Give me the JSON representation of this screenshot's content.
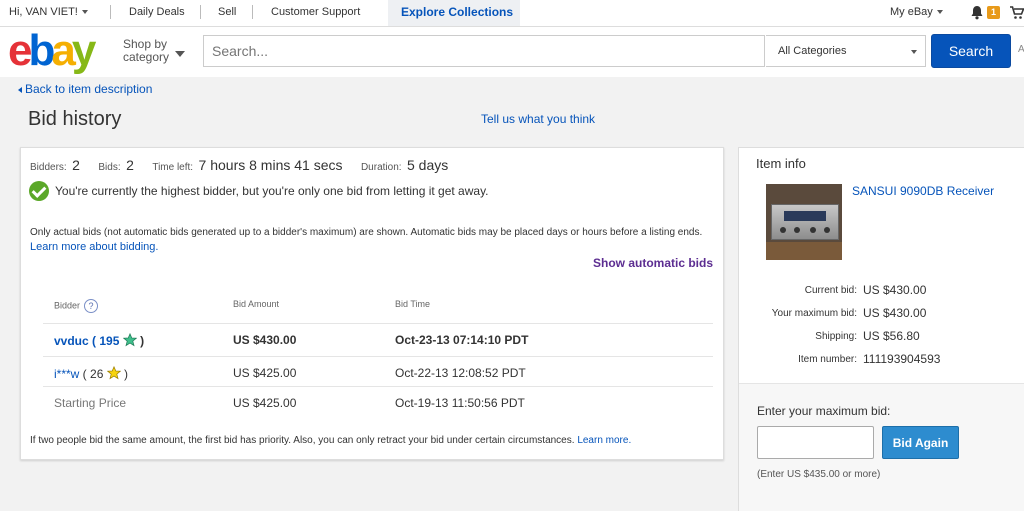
{
  "topbar": {
    "greeting": "Hi, VAN VIET!",
    "links": [
      "Daily Deals",
      "Sell",
      "Customer Support"
    ],
    "explore": "Explore Collections",
    "my_ebay": "My eBay",
    "notification_count": "1"
  },
  "header": {
    "shop_by": "Shop by",
    "category": "category",
    "search_placeholder": "Search...",
    "category_selected": "All Categories",
    "search_button": "Search",
    "advanced": "A"
  },
  "page": {
    "back_link": "Back to item description",
    "title": "Bid history",
    "feedback_link": "Tell us what you think"
  },
  "bids_summary": {
    "bidders_label": "Bidders:",
    "bidders": "2",
    "bids_label": "Bids:",
    "bids": "2",
    "time_left_label": "Time left:",
    "time_left": "7 hours 8 mins 41 secs",
    "duration_label": "Duration:",
    "duration": "5 days",
    "status_message": "You're currently the highest bidder, but you're only one bid from letting it get away.",
    "note": "Only actual bids (not automatic bids generated up to a bidder's maximum) are shown. Automatic bids may be placed days or hours before a listing ends.",
    "note_link": "Learn more about bidding.",
    "show_automatic": "Show automatic bids"
  },
  "bid_table": {
    "headers": {
      "bidder": "Bidder",
      "amount": "Bid Amount",
      "time": "Bid Time"
    },
    "help": "?",
    "rows": [
      {
        "bidder": "vvduc",
        "score": "195",
        "open": " ( ",
        "close": " )",
        "amount": "US $430.00",
        "time": "Oct-23-13 07:14:10 PDT",
        "star": "green-star-icon"
      },
      {
        "bidder": "i***w",
        "score": "26",
        "open": " ( ",
        "close": " )",
        "amount": "US $425.00",
        "time": "Oct-22-13 12:08:52 PDT",
        "star": "yellow-star-icon"
      }
    ],
    "starting": {
      "label": "Starting Price",
      "amount": "US $425.00",
      "time": "Oct-19-13 11:50:56 PDT"
    }
  },
  "footnote": {
    "text": "If two people bid the same amount, the first bid has priority. Also, you can only retract your bid under certain circumstances.",
    "link": "Learn more."
  },
  "item_info": {
    "title": "Item info",
    "item_name": "SANSUI 9090DB Receiver",
    "current_bid_label": "Current bid:",
    "current_bid": "US $430.00",
    "max_bid_label": "Your maximum bid:",
    "max_bid": "US $430.00",
    "shipping_label": "Shipping:",
    "shipping": "US $56.80",
    "item_number_label": "Item number:",
    "item_number": "111193904593",
    "enter_max_label": "Enter your maximum bid:",
    "bid_again": "Bid Again",
    "hint": "(Enter US $435.00 or more)"
  },
  "colors": {
    "accent": "#0654ba",
    "brand_red": "#e53238",
    "brand_blue": "#0064d2",
    "brand_yellow": "#f5af02",
    "brand_green": "#86b817",
    "purple": "#5c2d91"
  }
}
